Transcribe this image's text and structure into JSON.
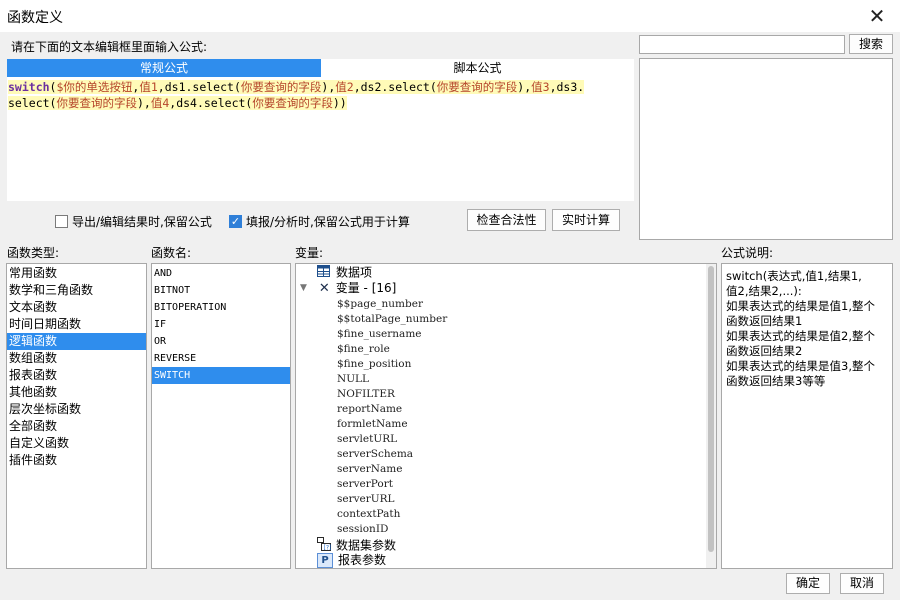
{
  "window": {
    "title": "函数定义",
    "close_glyph": "✕"
  },
  "input_prompt": "请在下面的文本编辑框里面输入公式:",
  "tabs": [
    {
      "label": "常规公式",
      "active": true
    },
    {
      "label": "脚本公式",
      "active": false
    }
  ],
  "formula": {
    "line1": [
      {
        "t": "switch",
        "c": "kw"
      },
      {
        "t": "(",
        "c": "pl"
      },
      {
        "t": "$你的单选按钮",
        "c": "str"
      },
      {
        "t": ",",
        "c": "pl"
      },
      {
        "t": "值1",
        "c": "str"
      },
      {
        "t": ",ds1.select(",
        "c": "pl"
      },
      {
        "t": "你要查询的字段",
        "c": "str"
      },
      {
        "t": "),",
        "c": "pl"
      },
      {
        "t": "值2",
        "c": "str"
      },
      {
        "t": ",ds2.select(",
        "c": "pl"
      },
      {
        "t": "你要查询的字段",
        "c": "str"
      },
      {
        "t": "),",
        "c": "pl"
      },
      {
        "t": "值3",
        "c": "str"
      },
      {
        "t": ",ds3.",
        "c": "pl"
      }
    ],
    "line2": [
      {
        "t": "select(",
        "c": "pl"
      },
      {
        "t": "你要查询的字段",
        "c": "str"
      },
      {
        "t": "),",
        "c": "pl"
      },
      {
        "t": "值4",
        "c": "str"
      },
      {
        "t": ",ds4.select(",
        "c": "pl"
      },
      {
        "t": "你要查询的字段",
        "c": "str"
      },
      {
        "t": "))",
        "c": "pl"
      }
    ]
  },
  "search": {
    "value": "",
    "button_label": "搜索"
  },
  "options": {
    "keep_formula_export": {
      "label": "导出/编辑结果时,保留公式",
      "checked": false
    },
    "keep_formula_fill": {
      "label": "填报/分析时,保留公式用于计算",
      "checked": true
    }
  },
  "buttons": {
    "check_validity": "检查合法性",
    "realtime_calc": "实时计算",
    "ok": "确定",
    "cancel": "取消"
  },
  "function_types": {
    "header": "函数类型:",
    "items": [
      "常用函数",
      "数学和三角函数",
      "文本函数",
      "时间日期函数",
      "逻辑函数",
      "数组函数",
      "报表函数",
      "其他函数",
      "层次坐标函数",
      "全部函数",
      "自定义函数",
      "插件函数"
    ],
    "selected_index": 4
  },
  "function_names": {
    "header": "函数名:",
    "items": [
      "AND",
      "BITNOT",
      "BITOPERATION",
      "IF",
      "OR",
      "REVERSE",
      "SWITCH"
    ],
    "selected_index": 6
  },
  "variables": {
    "header": "变量:",
    "data_items": "数据项",
    "variables_group": "变量 - [16]",
    "leaves": [
      "$$page_number",
      "$$totalPage_number",
      "$fine_username",
      "$fine_role",
      "$fine_position",
      "NULL",
      "NOFILTER",
      "reportName",
      "formletName",
      "servletURL",
      "serverSchema",
      "serverName",
      "serverPort",
      "serverURL",
      "contextPath",
      "sessionID"
    ],
    "dataset_params": "数据集参数",
    "report_params": "报表参数",
    "icons": {
      "data_items": "table-icon",
      "variables": "variable-x-icon",
      "dataset_params": "dataset-param-icon",
      "report_params": "report-param-icon",
      "expand": "triangle-down-icon"
    }
  },
  "description": {
    "header": "公式说明:",
    "lines": [
      "switch(表达式,值1,结果1,",
      "值2,结果2,...):",
      "如果表达式的结果是值1,整个",
      "函数返回结果1",
      "如果表达式的结果是值2,整个",
      "函数返回结果2",
      "如果表达式的结果是值3,整个",
      "函数返回结果3等等"
    ]
  },
  "colors": {
    "accent": "#2f8ded",
    "editor_highlight": "#fffbb8",
    "keyword": "#6b2fa0",
    "string": "#b5452a"
  }
}
